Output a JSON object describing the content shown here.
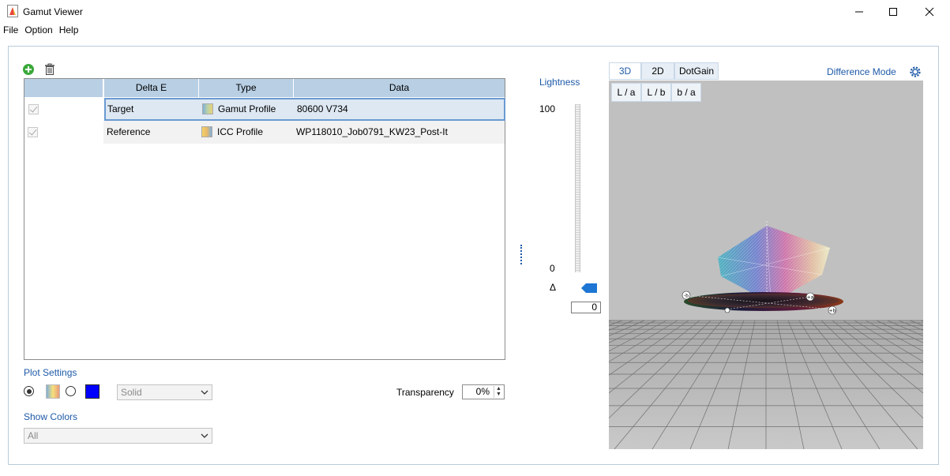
{
  "window": {
    "title": "Gamut Viewer",
    "minimize_glyph": "─",
    "maximize_glyph": "☐",
    "close_glyph": "✕"
  },
  "menu": [
    "File",
    "Option",
    "Help"
  ],
  "toolbar": {
    "add_icon": "add-circle-icon",
    "delete_icon": "trash-icon"
  },
  "table": {
    "columns": [
      "",
      "Delta E",
      "Type",
      "Data"
    ],
    "rows": [
      {
        "checked": true,
        "delta_e": "Target",
        "type": "Gamut Profile",
        "data": "80600 V734",
        "selected": true
      },
      {
        "checked": true,
        "delta_e": "Reference",
        "type": "ICC Profile",
        "data": "WP118010_Job0791_KW23_Post-It",
        "selected": false
      }
    ]
  },
  "plot_settings": {
    "label": "Plot Settings",
    "mode_selected": "gradient",
    "solid_color": "#0000ff",
    "style_select": "Solid",
    "transparency_label": "Transparency",
    "transparency_value": "0%"
  },
  "show_colors": {
    "label": "Show Colors",
    "select": "All"
  },
  "lightness": {
    "label": "Lightness",
    "max": "100",
    "min": "0",
    "delta_symbol": "Δ",
    "value": "0"
  },
  "view_tabs": [
    "3D",
    "2D",
    "DotGain"
  ],
  "active_tab": "3D",
  "sub_tabs": [
    "L / a",
    "L / b",
    "b / a"
  ],
  "difference_mode": "Difference Mode",
  "axis_markers": [
    "-b",
    "+a",
    "+b"
  ]
}
